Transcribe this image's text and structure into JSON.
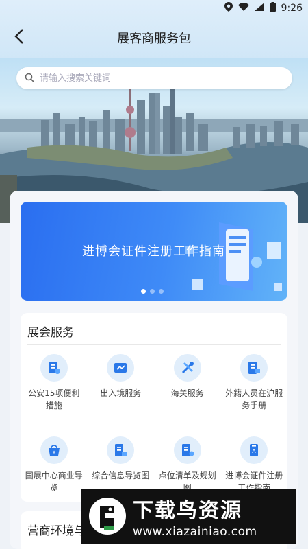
{
  "status": {
    "time": "9:26"
  },
  "header": {
    "title": "展客商服务包"
  },
  "search": {
    "placeholder": "请输入搜索关键词"
  },
  "banner": {
    "text": "进博会证件注册工作指南",
    "slides": 3,
    "active": 1
  },
  "section1": {
    "title": "展会服务",
    "items": [
      {
        "label": "公安15项便利措施",
        "icon": "police-doc-icon"
      },
      {
        "label": "出入境服务",
        "icon": "exit-entry-icon"
      },
      {
        "label": "海关服务",
        "icon": "customs-tools-icon"
      },
      {
        "label": "外籍人员在沪服务手册",
        "icon": "foreigner-manual-icon"
      },
      {
        "label": "国展中心商业导览",
        "icon": "shopping-basket-icon"
      },
      {
        "label": "综合信息导览图",
        "icon": "info-map-icon"
      },
      {
        "label": "点位清单及规划图",
        "icon": "location-list-icon"
      },
      {
        "label": "进博会证件注册工作指南",
        "icon": "badge-icon"
      }
    ]
  },
  "section2": {
    "title": "营商环境与"
  },
  "watermark": {
    "brand": "下载鸟资源",
    "url": "www.xiazainiao.com"
  },
  "colors": {
    "accent": "#2a6ef0",
    "icon_bg": "#e1eefb",
    "icon_fg": "#2a78e8"
  }
}
